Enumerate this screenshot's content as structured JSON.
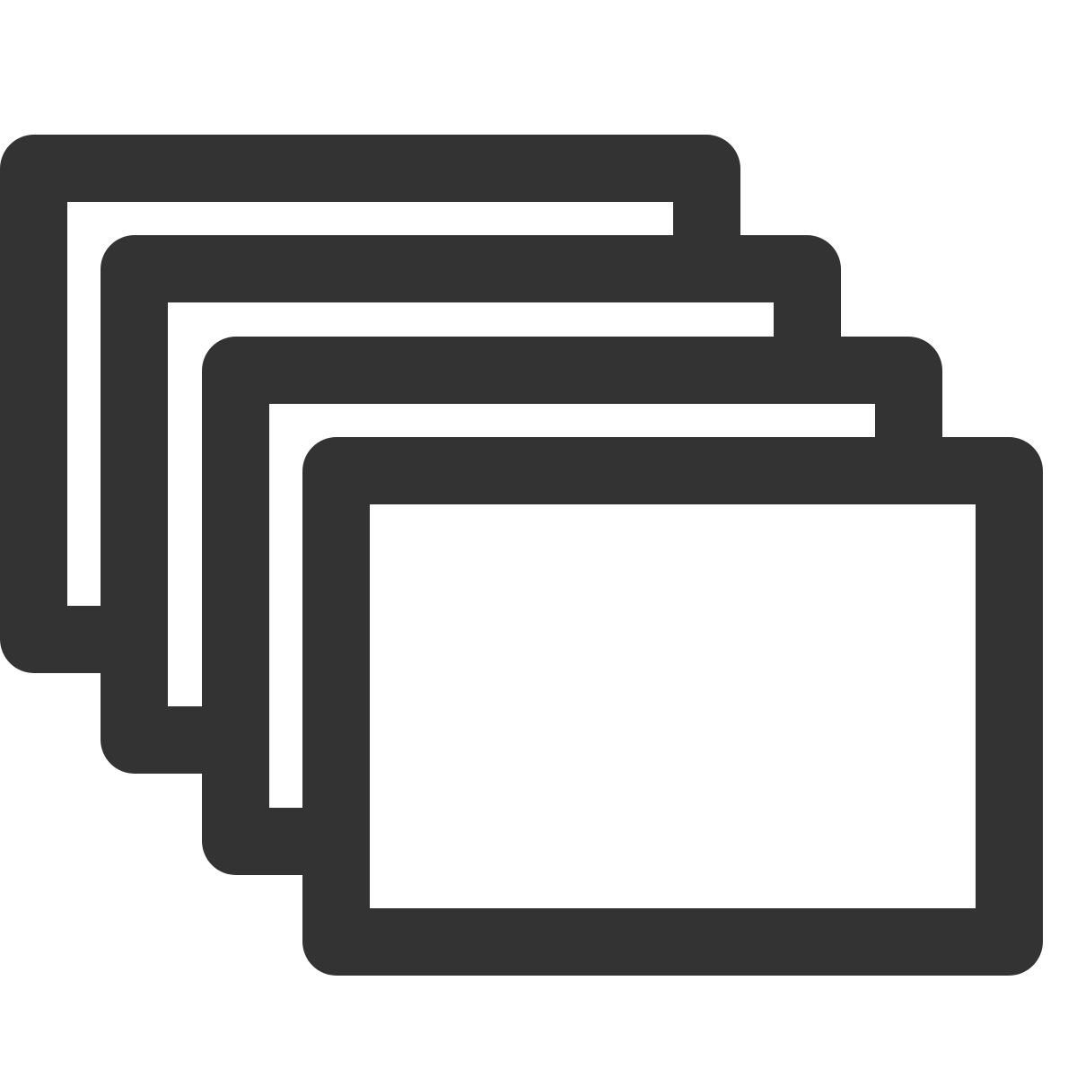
{
  "icon": {
    "name": "stacked-windows-icon",
    "stroke_color": "#333333",
    "background_color": "#ffffff",
    "window_count": 4
  }
}
